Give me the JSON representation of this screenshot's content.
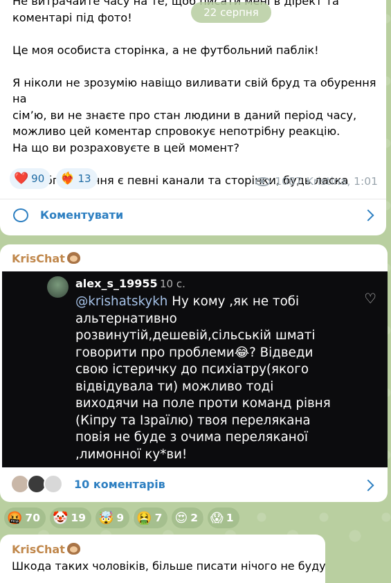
{
  "post": {
    "text": "Не витрачайте часу на те, щоб писати мені в дірект та\nкоментарі під фото!\n\nЦе моя особиста сторінка, а не футбольний паблік!\n\nЯ ніколи не зрозумію навіщо виливати свій бруд та обурення на\nсім’ю, ви не знаєте про стан людини в даний період часу,\nможливо цей коментар спровокує непотрібну реакцію.\nНа що ви розраховуєте в цей момент?\n\nДля обговорення є певні канали та сторінки, будь ласка",
    "date_pill": "22 серпня",
    "reactions": [
      {
        "emoji": "❤️",
        "count": "90"
      },
      {
        "emoji": "❤️‍🔥",
        "count": "13"
      }
    ],
    "views": "1087",
    "author_time": "Kristina, 1:01",
    "comment_button": "Коментувати"
  },
  "chat_msg": {
    "sender": "KrisChat",
    "screenshot": {
      "username": "alex_s_19955",
      "time": "10 с.",
      "mention": "@krishatskykh",
      "comment": " Ну кому ,як не тобі альтернативно розвинутій,дешевій,сільській шматі говорити про проблеми😂? Відведи свою істеричку до психіатру(якого відвідувала ти) можливо тоді виходячи на поле проти команд рівня (Кіпру та Ізраїлю) твоя перелякана повія не буде з очима переляканої ,лимонної ку*ви!"
    },
    "comments_label": "10 коментарів",
    "reactions": [
      {
        "emoji": "🤬",
        "count": "70"
      },
      {
        "emoji": "🤡",
        "count": "19"
      },
      {
        "emoji": "🤯",
        "count": "9"
      },
      {
        "emoji": "🤮",
        "count": "7"
      },
      {
        "emoji": "😍",
        "count": "2"
      },
      {
        "emoji": "😱",
        "count": "1"
      }
    ]
  },
  "next_msg": {
    "sender": "KrisChat",
    "text": "Шкода таких чоловіків, більше писати нічого не буду"
  }
}
